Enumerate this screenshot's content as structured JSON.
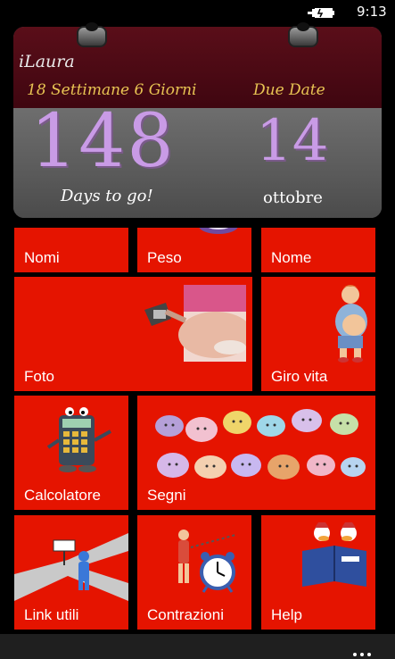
{
  "status_bar": {
    "time": "9:13",
    "battery_icon": "battery-charging-icon"
  },
  "header": {
    "app_title": "iLaura",
    "weeks_label": "18 Settimane 6 Giorni",
    "due_label": "Due Date",
    "days_remaining": "148",
    "days_caption": "Days to go!",
    "due_day": "14",
    "due_month": "ottobre"
  },
  "tiles": [
    {
      "label": "Nomi"
    },
    {
      "label": "Peso"
    },
    {
      "label": "Nome"
    },
    {
      "label": "Foto"
    },
    {
      "label": "Giro vita"
    },
    {
      "label": "Calcolatore"
    },
    {
      "label": "Segni"
    },
    {
      "label": "Link utili"
    },
    {
      "label": "Contrazioni"
    },
    {
      "label": "Help"
    }
  ],
  "app_bar": {
    "more_icon": "ellipsis-icon"
  },
  "colors": {
    "tile": "#e51400",
    "header_top": "#4a0a14",
    "header_bottom": "#636363",
    "accent_text": "#e8c453",
    "number_text": "#c99be6"
  }
}
